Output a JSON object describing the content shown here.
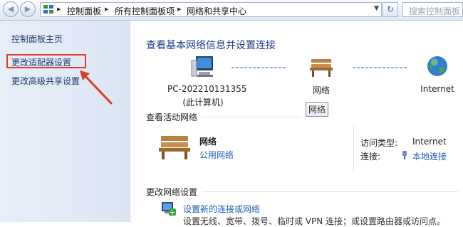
{
  "address_bar": {
    "crumbs": [
      "控制面板",
      "所有控制面板项",
      "网络和共享中心"
    ],
    "search_placeholder": "搜索控制面板"
  },
  "sidebar": {
    "items": [
      {
        "label": "控制面板主页"
      },
      {
        "label": "更改适配器设置",
        "highlighted": true
      },
      {
        "label": "更改高级共享设置"
      }
    ],
    "highlight_color": "#e23a2a"
  },
  "main": {
    "title": "查看基本网络信息并设置连接",
    "map": {
      "computer_name": "PC-202210131355",
      "computer_sub": "(此计算机)",
      "network_label": "网络",
      "internet_label": "Internet",
      "tooltip": "网络"
    },
    "active": {
      "heading": "查看活动网络",
      "network_name": "网络",
      "network_type": "公用网络",
      "access_type_label": "访问类型:",
      "access_type_value": "Internet",
      "connection_label": "连接:",
      "connection_value": "本地连接"
    },
    "change": {
      "heading": "更改网络设置",
      "setup_link": "设置新的连接或网络",
      "setup_desc": "设置无线、宽带、拨号、临时或 VPN 连接；或设置路由器或访问点。"
    }
  },
  "colors": {
    "title": "#1e3a8a",
    "link": "#1f5fb5",
    "sidebar": "#e7eef8"
  }
}
